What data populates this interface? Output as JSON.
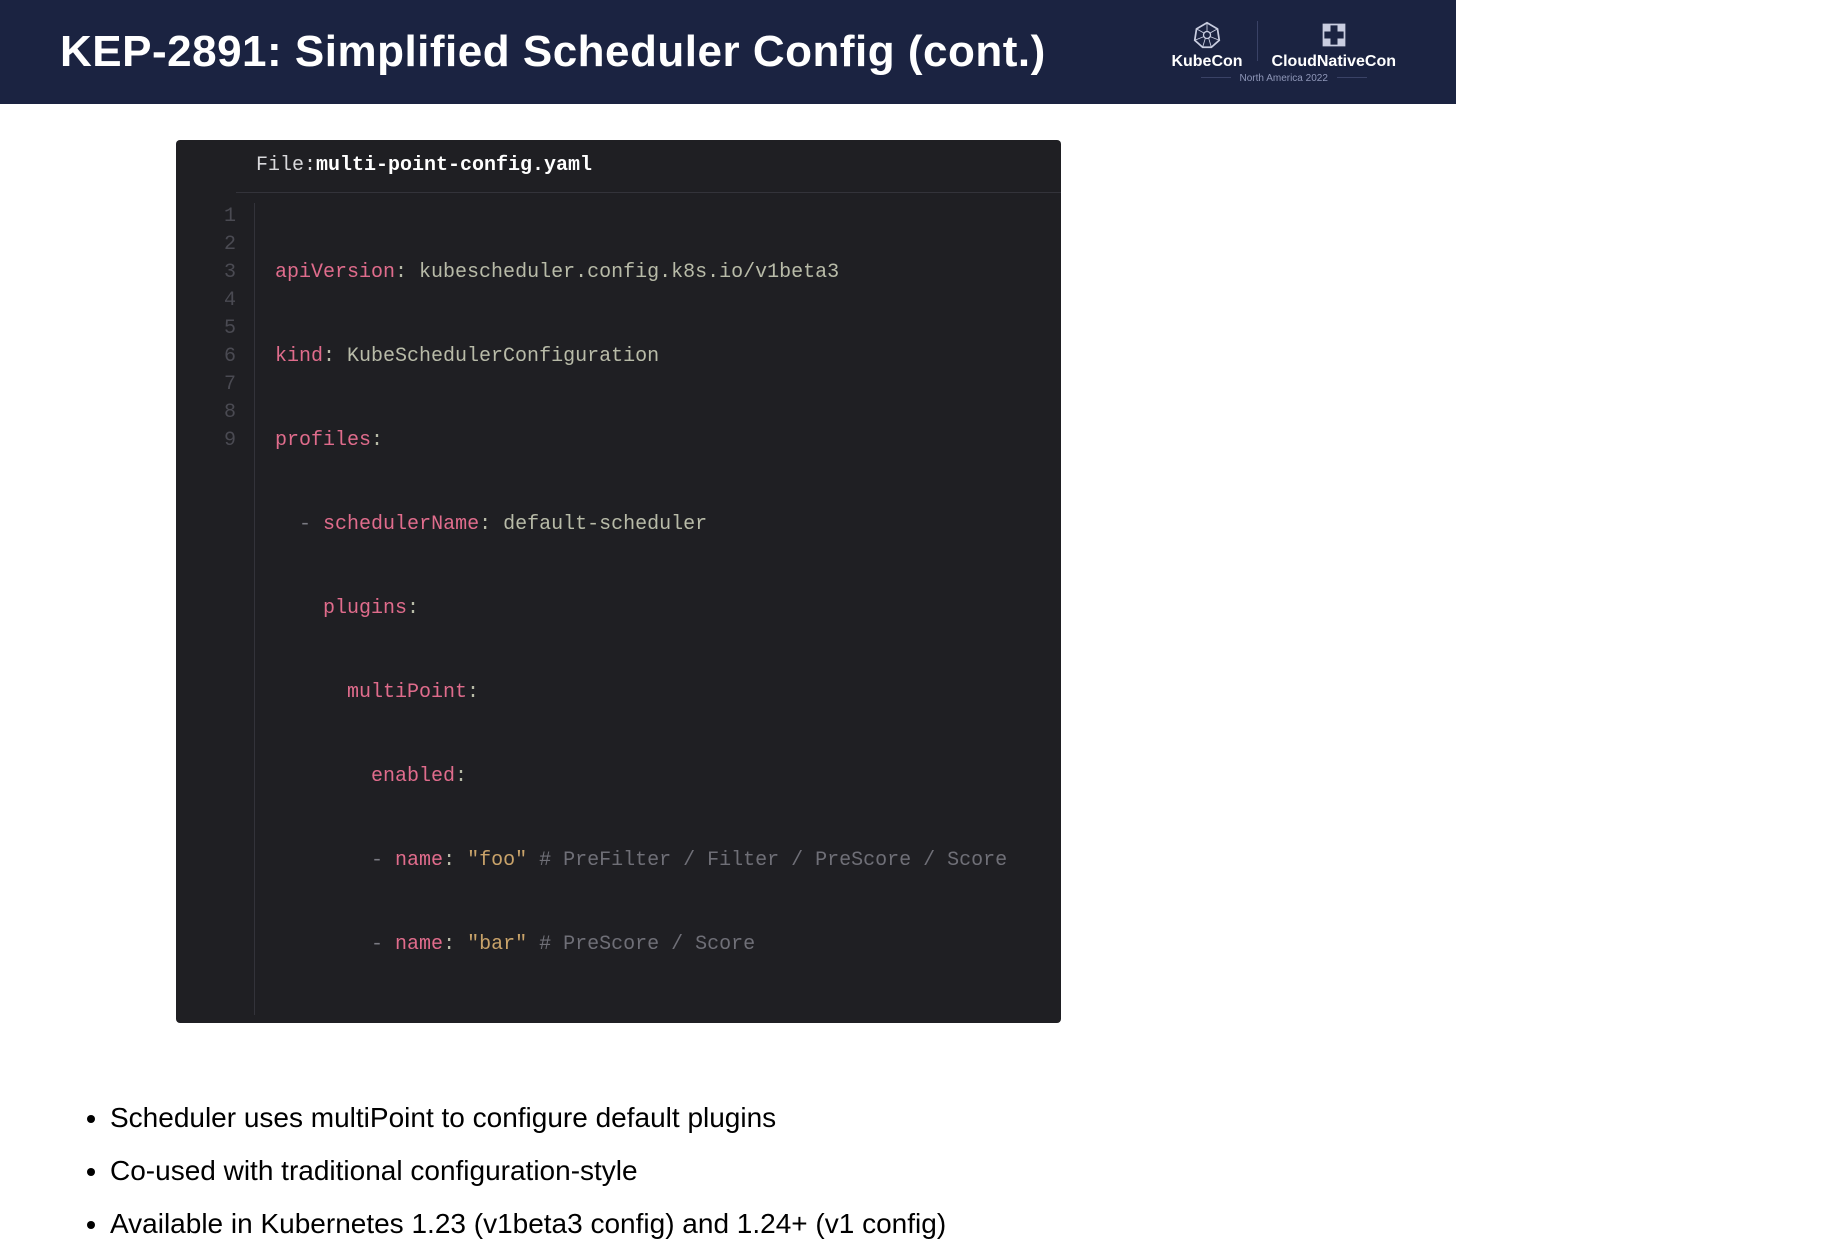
{
  "header": {
    "title": "KEP-2891: Simplified Scheduler Config (cont.)",
    "logo1": "KubeCon",
    "logo2": "CloudNativeCon",
    "event": "North America 2022"
  },
  "code": {
    "file_label": "File: ",
    "filename": "multi-point-config.yaml",
    "gutter": [
      "1",
      "2",
      "3",
      "4",
      "5",
      "6",
      "7",
      "8",
      "9"
    ],
    "lines": {
      "l1_key": "apiVersion",
      "l1_val": "kubescheduler.config.k8s.io/v1beta3",
      "l2_key": "kind",
      "l2_val": "KubeSchedulerConfiguration",
      "l3_key": "profiles",
      "l4_dash": "-",
      "l4_key": "schedulerName",
      "l4_val": "default-scheduler",
      "l5_key": "plugins",
      "l6_key": "multiPoint",
      "l7_key": "enabled",
      "l8_dash": "-",
      "l8_key": "name",
      "l8_val": "\"foo\"",
      "l8_comment": "# PreFilter / Filter / PreScore / Score",
      "l9_dash": "-",
      "l9_key": "name",
      "l9_val": "\"bar\"",
      "l9_comment": "# PreScore / Score"
    }
  },
  "bullets": {
    "b1": "Scheduler uses multiPoint to configure default plugins",
    "b2": "Co-used with traditional configuration-style",
    "b3": "Available in Kubernetes 1.23 (v1beta3 config) and 1.24+ (v1 config)"
  }
}
